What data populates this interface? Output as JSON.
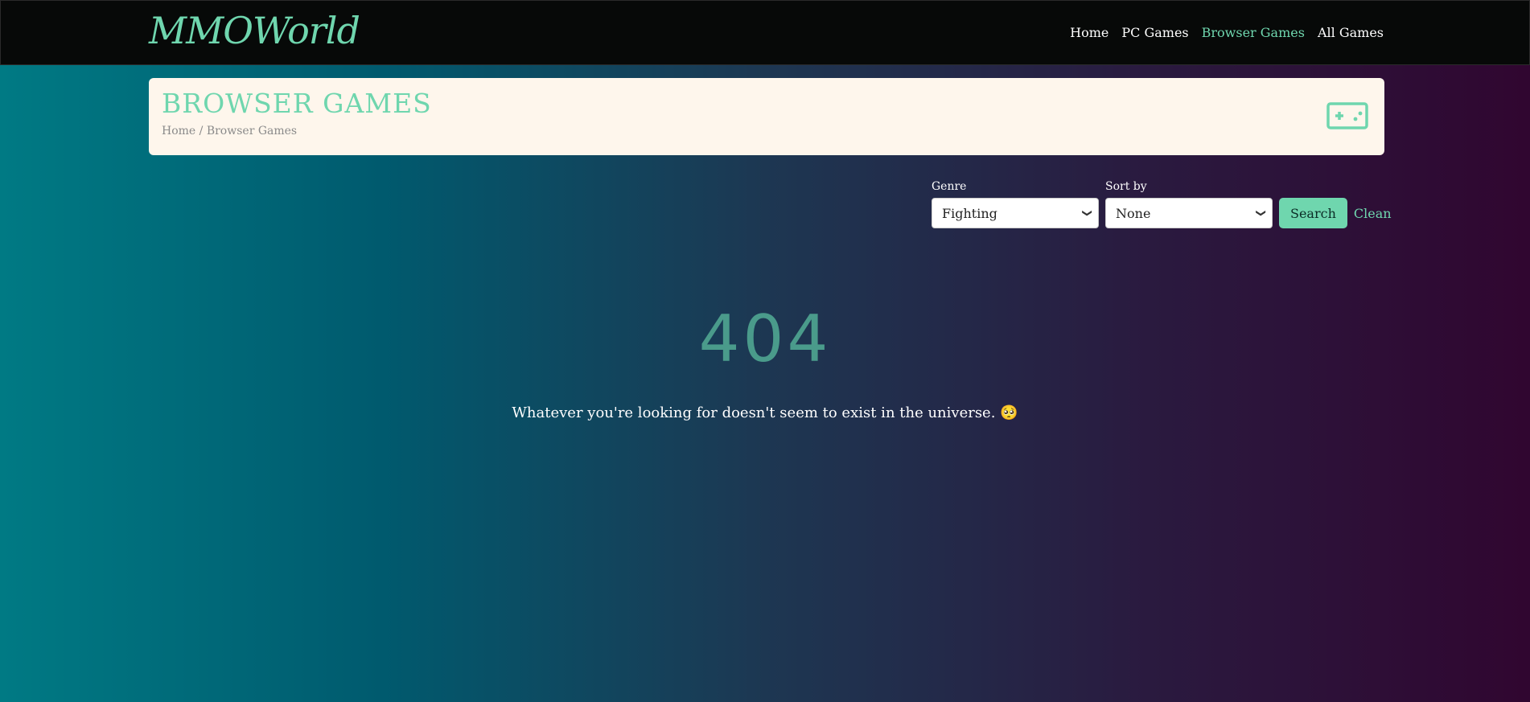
{
  "brand": "MMOWorld",
  "nav": {
    "items": [
      {
        "label": "Home",
        "active": false
      },
      {
        "label": "PC Games",
        "active": false
      },
      {
        "label": "Browser Games",
        "active": true
      },
      {
        "label": "All Games",
        "active": false
      }
    ]
  },
  "header": {
    "title": "BROWSER GAMES",
    "breadcrumb": {
      "home": "Home",
      "separator": "/",
      "current": "Browser Games"
    },
    "icon": "gamepad-icon"
  },
  "filters": {
    "genre_label": "Genre",
    "genre_value": "Fighting",
    "sort_label": "Sort by",
    "sort_value": "None",
    "search_label": "Search",
    "clean_label": "Clean"
  },
  "error": {
    "code": "404",
    "message": "Whatever you're looking for doesn't seem to exist in the universe. 🥺"
  },
  "colors": {
    "accent": "#6fd6ae",
    "navbar": "#070908",
    "card": "#fef6ec"
  }
}
